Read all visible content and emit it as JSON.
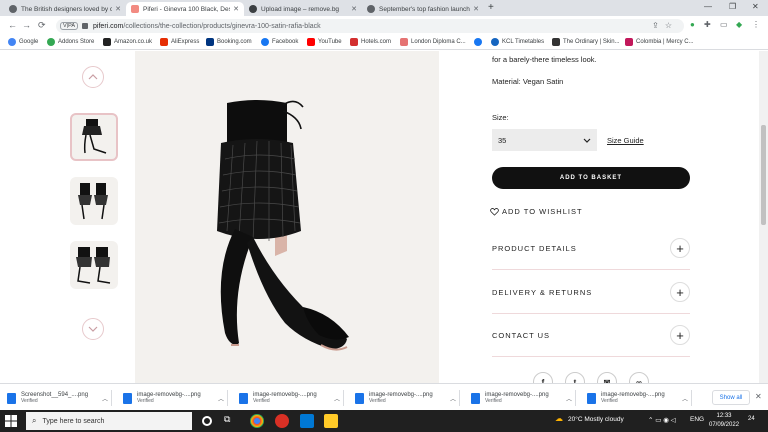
{
  "browser": {
    "tabs": [
      {
        "title": "The British designers loved by cele",
        "active": false,
        "favicon_color": "#5f6368"
      },
      {
        "title": "Piferi - Ginevra 100 Black, Designe",
        "active": true,
        "favicon_color": "#f28b82"
      },
      {
        "title": "Upload image – remove.bg",
        "active": false,
        "favicon_color": "#3c4043"
      },
      {
        "title": "September's top fashion launches:",
        "active": false,
        "favicon_color": "#5f6368"
      }
    ],
    "new_tab": "+",
    "toolbar": {
      "back": "←",
      "forward": "→",
      "reload": "⟳",
      "profile_chip": "V|PA",
      "url_host": "piferi.com",
      "url_path": "/collections/the-collection/products/ginevra-100-satin-rafia-black"
    },
    "bookmarks": [
      {
        "label": "Google",
        "color": "#4285f4"
      },
      {
        "label": "Addons Store",
        "color": "#34a853"
      },
      {
        "label": "Amazon.co.uk",
        "color": "#222222"
      },
      {
        "label": "AliExpress",
        "color": "#e62e04"
      },
      {
        "label": "Booking.com",
        "color": "#003580"
      },
      {
        "label": "Facebook",
        "color": "#1877f2"
      },
      {
        "label": "YouTube",
        "color": "#ff0000"
      },
      {
        "label": "Hotels.com",
        "color": "#d32f2f"
      },
      {
        "label": "London Diploma C...",
        "color": "#e57373"
      },
      {
        "label": "",
        "color": "#1877f2"
      },
      {
        "label": "KCL Timetables",
        "color": "#1565c0"
      },
      {
        "label": "The Ordinary | Skin...",
        "color": "#333333"
      },
      {
        "label": "Colombia | Mercy C...",
        "color": "#c2185b"
      }
    ]
  },
  "product": {
    "description_tail": "for a barely-there timeless look.",
    "material": "Material: Vegan Satin",
    "size_label": "Size:",
    "size_value": "35",
    "size_guide": "Size Guide",
    "add_to_basket": "ADD TO BASKET",
    "wishlist": "ADD TO WISHLIST",
    "accordion": [
      {
        "label": "PRODUCT DETAILS"
      },
      {
        "label": "DELIVERY & RETURNS"
      },
      {
        "label": "CONTACT US"
      }
    ],
    "social": [
      "f",
      "t",
      "✉",
      "∞"
    ]
  },
  "downloads": {
    "items": [
      {
        "name": "Screenshot__594_....png",
        "status": "Verified"
      },
      {
        "name": "image-removebg-....png",
        "status": "Verified"
      },
      {
        "name": "image-removebg-....png",
        "status": "Verified"
      },
      {
        "name": "image-removebg-....png",
        "status": "Verified"
      },
      {
        "name": "image-removebg-....png",
        "status": "Verified"
      },
      {
        "name": "image-removebg-....png",
        "status": "Verified"
      }
    ],
    "show_all": "Show all"
  },
  "taskbar": {
    "search_placeholder": "Type here to search",
    "weather": "20°C  Mostly cloudy",
    "language": "ENG",
    "time": "12:33",
    "date": "07/09/2022",
    "notification_count": "24"
  }
}
